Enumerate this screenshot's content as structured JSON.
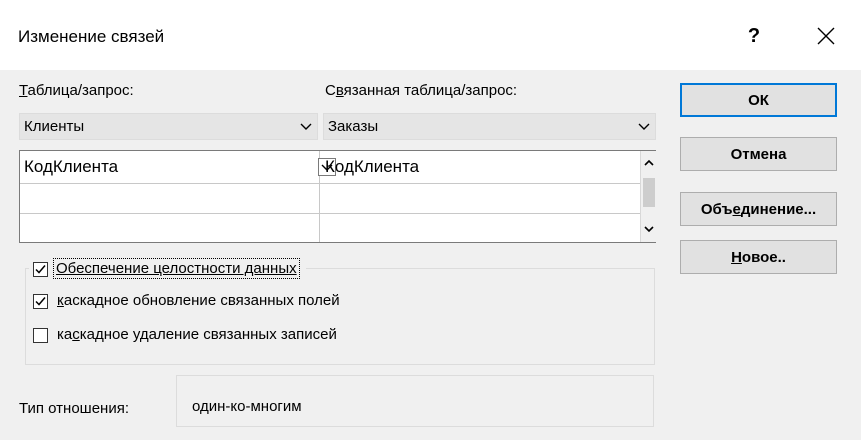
{
  "dialog": {
    "title": "Изменение связей",
    "help": "?",
    "close_icon": "close-icon"
  },
  "table": {
    "label_pre": "",
    "label_u": "Т",
    "label_post": "аблица/запрос:",
    "value": "Клиенты"
  },
  "related": {
    "label_pre": "С",
    "label_u": "в",
    "label_post": "язанная таблица/запрос:",
    "value": "Заказы"
  },
  "grid": {
    "rows": [
      {
        "left": "КодКлиента",
        "right": "КодКлиента"
      },
      {
        "left": "",
        "right": ""
      },
      {
        "left": "",
        "right": ""
      }
    ]
  },
  "integrity": {
    "label": "Обеспечение целостности данных",
    "checked": true
  },
  "cascade_update": {
    "label_u": "к",
    "label_post": "аскадное обновление связанных полей",
    "checked": true
  },
  "cascade_delete": {
    "label_pre": "ка",
    "label_u": "с",
    "label_post": "кадное удаление связанных записей",
    "checked": false
  },
  "relationship": {
    "label": "Тип отношения:",
    "value": "один-ко-многим"
  },
  "buttons": {
    "ok": "ОК",
    "cancel": "Отмена",
    "join_pre": "Объ",
    "join_u": "е",
    "join_post": "динение...",
    "new_u": "Н",
    "new_post": "овое.."
  },
  "colors": {
    "accent": "#0078d7",
    "dialog_bg": "#f0f0f0"
  }
}
